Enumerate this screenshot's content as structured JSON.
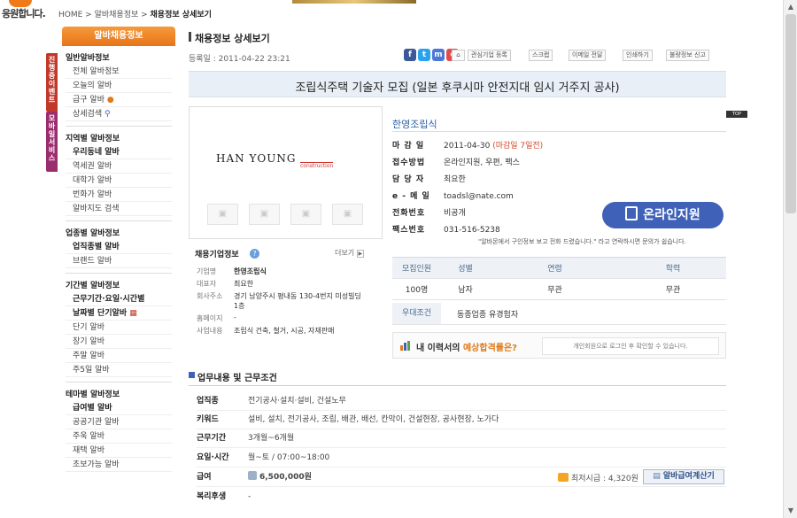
{
  "header": {
    "logo_text": "응원합니다.",
    "breadcrumb_home": "HOME",
    "breadcrumb_sep1": " > ",
    "breadcrumb_2": "알바채용정보",
    "breadcrumb_sep2": " > ",
    "breadcrumb_3": "채용정보 상세보기"
  },
  "side_tabs": {
    "tab1": "진행중이벤트",
    "tab2": "모바일서비스"
  },
  "sidebar": {
    "head": "알바채용정보",
    "groups": [
      {
        "title": "일반알바정보",
        "items": [
          "전체 알바정보",
          "오늘의 알바",
          "급구 알바",
          "상세검색"
        ]
      },
      {
        "title": "지역별 알바정보",
        "items": [
          "우리동네 알바",
          "역세권 알바",
          "대학가 알바",
          "번화가 알바",
          "알바지도 검색"
        ]
      },
      {
        "title": "업종별 알바정보",
        "items": [
          "업직종별 알바",
          "브랜드 알바"
        ]
      },
      {
        "title": "기간별 알바정보",
        "items": [
          "근무기간·요일·시간별",
          "날짜별 단기알바",
          "단기 알바",
          "장기 알바",
          "주말 알바",
          "주5일 알바"
        ]
      },
      {
        "title": "테마별 알바정보",
        "items": [
          "급여별 알바",
          "공공기관 알바",
          "주욱 알바",
          "재택 알바",
          "초보가능 알바"
        ]
      }
    ]
  },
  "page": {
    "title": "채용정보 상세보기",
    "reg_label": "등록일 : ",
    "reg_date": "2011-04-22 23:21",
    "sns": [
      "f",
      "t",
      "m",
      "c"
    ],
    "tools": [
      "관심기업 등록",
      "스크랩",
      "이메일 전달",
      "인쇄하기",
      "불량정보 신고"
    ],
    "job_title": "조립식주택 기술자 모집 (일본 후쿠시마 안전지대 임시 거주지 공사)",
    "top_label": "TOP"
  },
  "logo": {
    "main": "HAN YOUNG",
    "sub": "construction"
  },
  "company_info": {
    "title": "채용기업정보",
    "more": "더보기",
    "rows": [
      {
        "k": "기업명",
        "v": "한영조립식"
      },
      {
        "k": "대표자",
        "v": "최요한"
      },
      {
        "k": "회사주소",
        "v": "경기 남양주시 평내동 130-4번지 미성빌딩 1층"
      },
      {
        "k": "홈페이지",
        "v": "-"
      },
      {
        "k": "사업내용",
        "v": "조립식 건축, 철거, 시공, 자재판매"
      }
    ]
  },
  "detail": {
    "company": "한영조립식",
    "rows": [
      {
        "k": "마 감 일",
        "v": "2011-04-30",
        "note": "(마감일 7일전)"
      },
      {
        "k": "접수방법",
        "v": "온라인지원, 우편, 팩스",
        "note": ""
      },
      {
        "k": "담 당 자",
        "v": "최요한",
        "note": ""
      },
      {
        "k": "e - 메 일",
        "v": "toadsl@nate.com",
        "note": ""
      },
      {
        "k": "전화번호",
        "v": "비공개",
        "note": ""
      },
      {
        "k": "팩스번호",
        "v": "031-516-5238",
        "note": ""
      }
    ],
    "apply_label": "온라인지원",
    "notice": "\"알바몬에서 구인정보 보고 전화 드렸습니다.\" 라고 연락하시면 문의가 쉽습니다."
  },
  "requirements": {
    "headers": [
      "모집인원",
      "성별",
      "연령",
      "학력"
    ],
    "values": [
      "100명",
      "남자",
      "무관",
      "무관"
    ],
    "pref_label": "우대조건",
    "pref_value": "동종업종 유경험자"
  },
  "rate": {
    "title_prefix": "내 이력서의 ",
    "title_em": "예상합격률은?",
    "button": "개인회원으로 로그인 후 확인할 수 있습니다."
  },
  "work": {
    "title": "업무내용 및 근무조건",
    "rows": [
      {
        "k": "업직종",
        "v": "전기공사·설치·설비, 건설노무"
      },
      {
        "k": "키워드",
        "v": "설비, 설치, 전기공사, 조립, 배관, 배선, 칸막이, 건설현장, 공사현장, 노가다"
      },
      {
        "k": "근무기간",
        "v": "3개월~6개월"
      },
      {
        "k": "요일·시간",
        "v": "월~토 / 07:00~18:00"
      },
      {
        "k": "급여",
        "v": "6,500,000원"
      },
      {
        "k": "복리후생",
        "v": "-"
      }
    ],
    "min_wage": "최저시급 : 4,320원",
    "calc_button": "알바급여계산기"
  },
  "colors": {
    "accent_orange": "#e8741b",
    "link_blue": "#2c5fa0",
    "apply_blue": "#3f61b8",
    "deadline_red": "#d04a2a"
  }
}
